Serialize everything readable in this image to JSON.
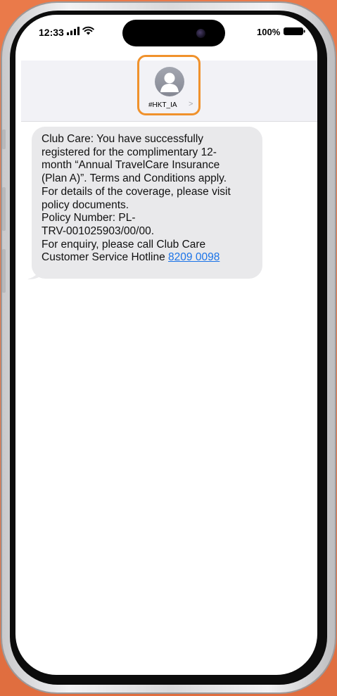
{
  "status_bar": {
    "time": "12:33",
    "battery_percent": "100%",
    "icons": [
      "signal-icon",
      "wifi-icon",
      "battery-icon"
    ]
  },
  "conversation": {
    "contact_name": "#HKT_IA",
    "chevron": ">",
    "highlight_color": "#f0922c"
  },
  "message": {
    "lines": [
      "Club Care: You have successfully",
      "registered for the complimentary 12-",
      "month “Annual TravelCare Insurance",
      "(Plan A)”. Terms and Conditions apply.",
      "For details of the coverage, please visit",
      "policy documents.",
      "Policy Number: PL-",
      "TRV-001025903/00/00.",
      "For enquiry, please call Club Care"
    ],
    "last_line_prefix": "Customer Service Hotline ",
    "phone_link": "8209 0098"
  },
  "colors": {
    "background": "#e57647",
    "bubble": "#e9e9eb",
    "link": "#1a73e8"
  }
}
